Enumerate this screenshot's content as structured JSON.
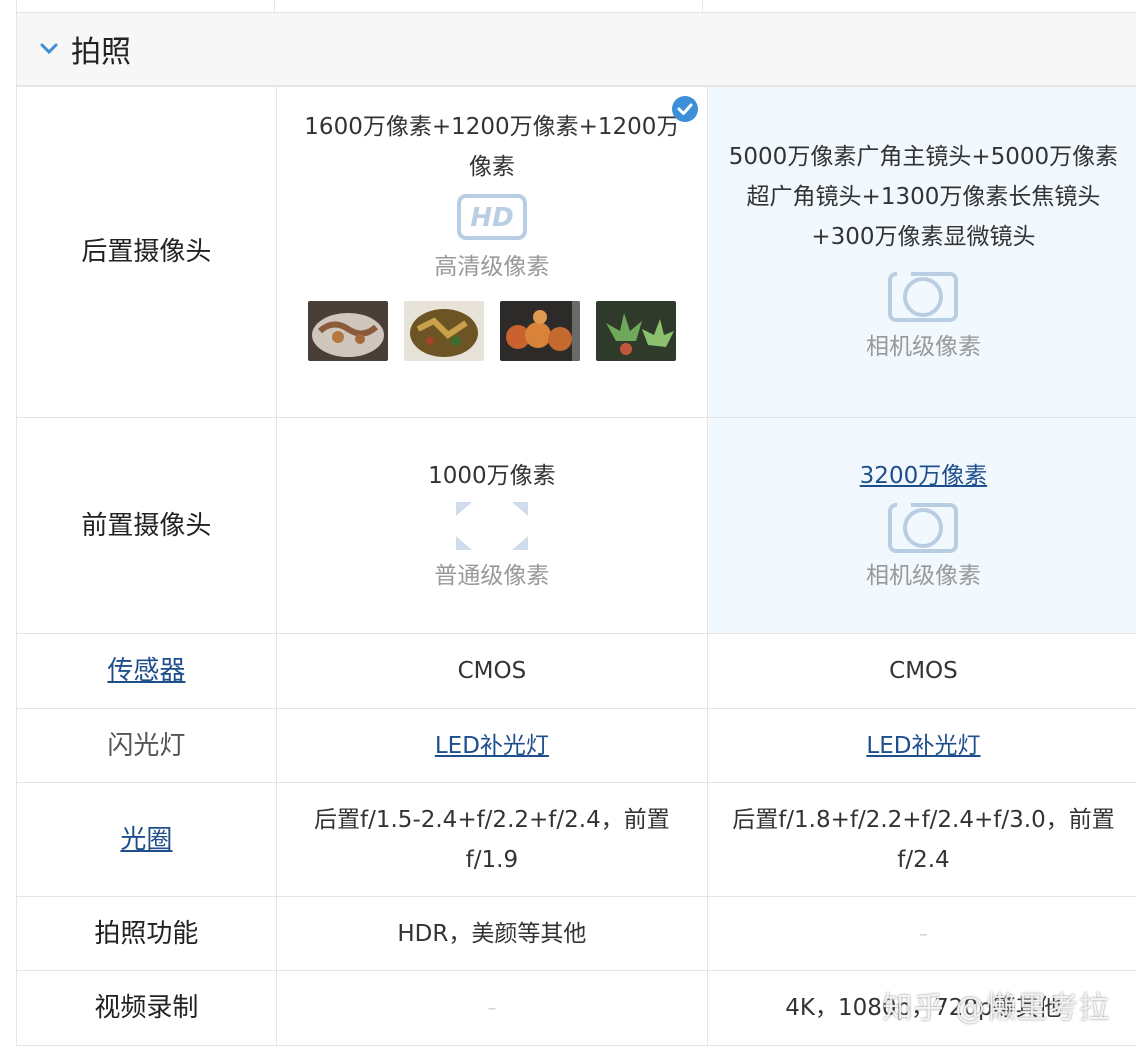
{
  "section": {
    "title": "拍照"
  },
  "rows": {
    "rear_camera": {
      "label": "后置摄像头",
      "phone1": {
        "spec": "1600万像素+1200万像素+1200万像素",
        "tier": "高清级像素",
        "icon": "hd-icon"
      },
      "phone2": {
        "spec": "5000万像素广角主镜头+5000万像素超广角镜头+1300万像素长焦镜头+300万像素显微镜头",
        "tier": "相机级像素",
        "icon": "camera-lens-icon"
      }
    },
    "front_camera": {
      "label": "前置摄像头",
      "phone1": {
        "spec": "1000万像素",
        "tier": "普通级像素",
        "icon": "viewfinder-icon"
      },
      "phone2": {
        "spec": "3200万像素",
        "tier": "相机级像素",
        "icon": "camera-lens-icon"
      }
    },
    "sensor": {
      "label": "传感器",
      "phone1": "CMOS",
      "phone2": "CMOS"
    },
    "flash": {
      "label": "闪光灯",
      "phone1": "LED补光灯",
      "phone2": "LED补光灯"
    },
    "aperture": {
      "label": "光圈",
      "phone1": "后置f/1.5-2.4+f/2.2+f/2.4，前置f/1.9",
      "phone2": "后置f/1.8+f/2.2+f/2.4+f/3.0，前置f/2.4"
    },
    "photo_features": {
      "label": "拍照功能",
      "phone1": "HDR，美颜等其他",
      "phone2": "–"
    },
    "video": {
      "label": "视频录制",
      "phone1": "–",
      "phone2": "4K，1080p，720p等其他"
    }
  },
  "watermark": "知乎 @懒里考拉",
  "colors": {
    "link": "#1f4e8c",
    "highlight_bg": "#f1f8fe",
    "header_bg": "#f7f7f7",
    "chevron": "#3d8fd8",
    "check_badge": "#3d8fd8"
  }
}
